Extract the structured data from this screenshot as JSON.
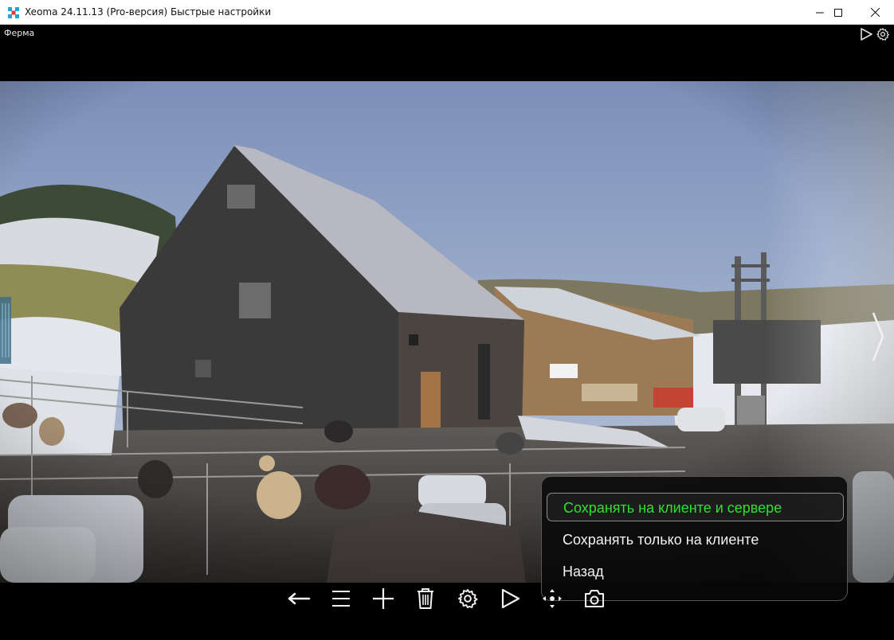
{
  "window": {
    "title": "Xeoma 24.11.13 (Pro-версия) Быстрые настройки",
    "buttons": [
      "minimize",
      "maximize",
      "close"
    ]
  },
  "camera": {
    "name": "Ферма"
  },
  "top_icons": [
    "play-icon",
    "gear-icon"
  ],
  "save_menu": {
    "items": [
      {
        "label": "Сохранять на клиенте и сервере",
        "active": true
      },
      {
        "label": "Сохранять только на клиенте",
        "active": false
      },
      {
        "label": "Назад",
        "active": false
      }
    ],
    "active_color": "#2fe12f"
  },
  "toolbar": {
    "buttons": [
      "back-arrow-icon",
      "menu-list-icon",
      "add-icon",
      "trash-icon",
      "settings-gear-icon",
      "play-icon",
      "move-icon",
      "camera-snapshot-icon"
    ]
  },
  "colors": {
    "background": "#000000",
    "titlebar": "#ffffff",
    "accent": "#2fe12f"
  }
}
